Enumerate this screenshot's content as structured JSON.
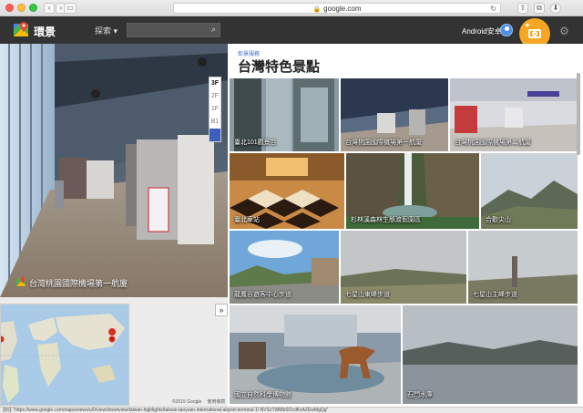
{
  "browser": {
    "url": "google.com",
    "status_url": "前往 \"https://www.google.com/maps/views/u/0/view/streetview/taiwan-highlights/taiwan-taoyuan-international-airport-terminal-1/-NVSzTWMbSOcdKxAZEwMgQg\""
  },
  "header": {
    "app_title": "環景",
    "explore_label": "探索 ▾",
    "search_value": "",
    "user_name": "Android安卓"
  },
  "floor_selector": {
    "floors": [
      "3F",
      "2F",
      "1F",
      "B1"
    ],
    "active": "3F"
  },
  "pano": {
    "caption": "台灣桃園國際機場第一航廈"
  },
  "panel": {
    "breadcrumb": "街景服務",
    "title": "台灣特色景點",
    "tiles": [
      {
        "label": "臺北101觀景台"
      },
      {
        "label": "台灣桃園國際機場第一航廈"
      },
      {
        "label": "台灣桃園國際機場第二航廈"
      },
      {
        "label": "臺北車站"
      },
      {
        "label": "杉林溪森林生態渡假園區"
      },
      {
        "label": "合歡尖山"
      },
      {
        "label": "龍鳳谷遊客中心步道"
      },
      {
        "label": "七星山東峰步道"
      },
      {
        "label": "七星山主峰步道"
      },
      {
        "label": "國立自然科學博物館"
      },
      {
        "label": "石門水庫"
      }
    ]
  },
  "map": {
    "copyright": "©2015 Google",
    "terms": "使用條款"
  },
  "icons": {
    "search": "search-icon",
    "settings": "gear-icon",
    "camera": "camera-icon",
    "collapse": "chevron-double-right-icon"
  },
  "colors": {
    "header_bg": "#333333",
    "fab": "#f5a623",
    "link": "#3b6fd1"
  }
}
